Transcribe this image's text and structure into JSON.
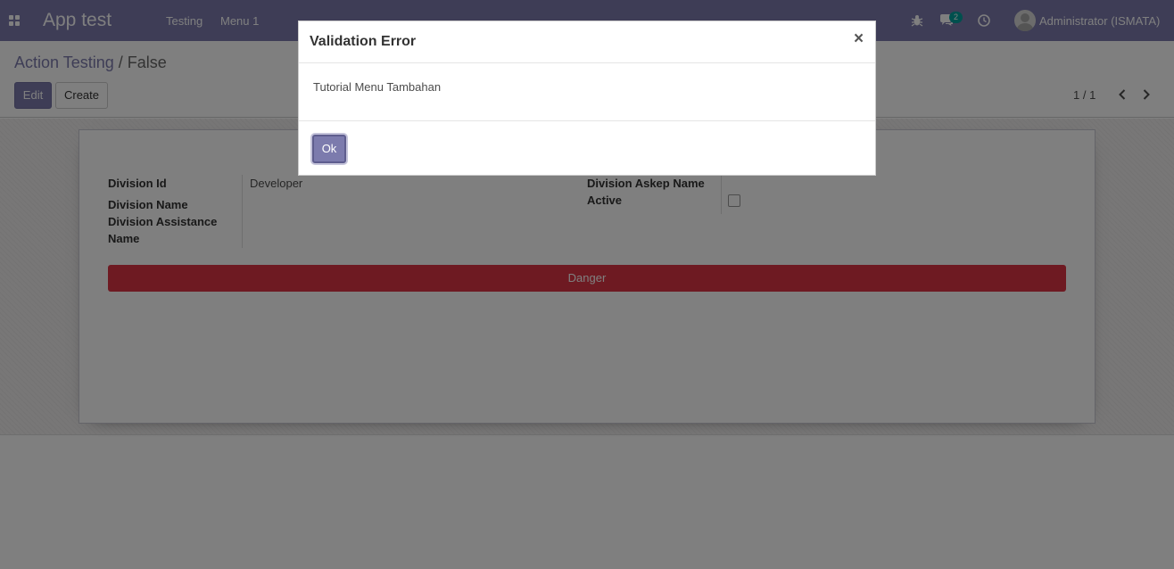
{
  "colors": {
    "navbar": "#7c7bad",
    "primary": "#7c7bad",
    "danger": "#dc3545",
    "badge": "#00a09d"
  },
  "navbar": {
    "app_title": "App test",
    "menus": [
      "Testing",
      "Menu 1"
    ],
    "icons": [
      "apps-grid-icon",
      "bug-icon",
      "chat-icon",
      "clock-icon"
    ],
    "messages_badge": "2",
    "user_name": "Administrator (ISMATA)"
  },
  "control_panel": {
    "breadcrumb": {
      "parent": "Action Testing",
      "separator": "/",
      "current": "False"
    },
    "buttons": {
      "edit": "Edit",
      "create": "Create"
    },
    "pager": {
      "value": "1 / 1"
    }
  },
  "form": {
    "left_fields": [
      {
        "label": "Division Id",
        "value": "Developer"
      },
      {
        "label": "Division Name",
        "value": ""
      },
      {
        "label": "Division Assistance Name",
        "value": ""
      }
    ],
    "right_fields": [
      {
        "label": "Division Askep Name",
        "value": ""
      },
      {
        "label": "Active",
        "checked": false
      }
    ],
    "danger_button": "Danger"
  },
  "modal": {
    "title": "Validation Error",
    "close": "×",
    "message": "Tutorial Menu Tambahan",
    "ok_button": "Ok"
  }
}
